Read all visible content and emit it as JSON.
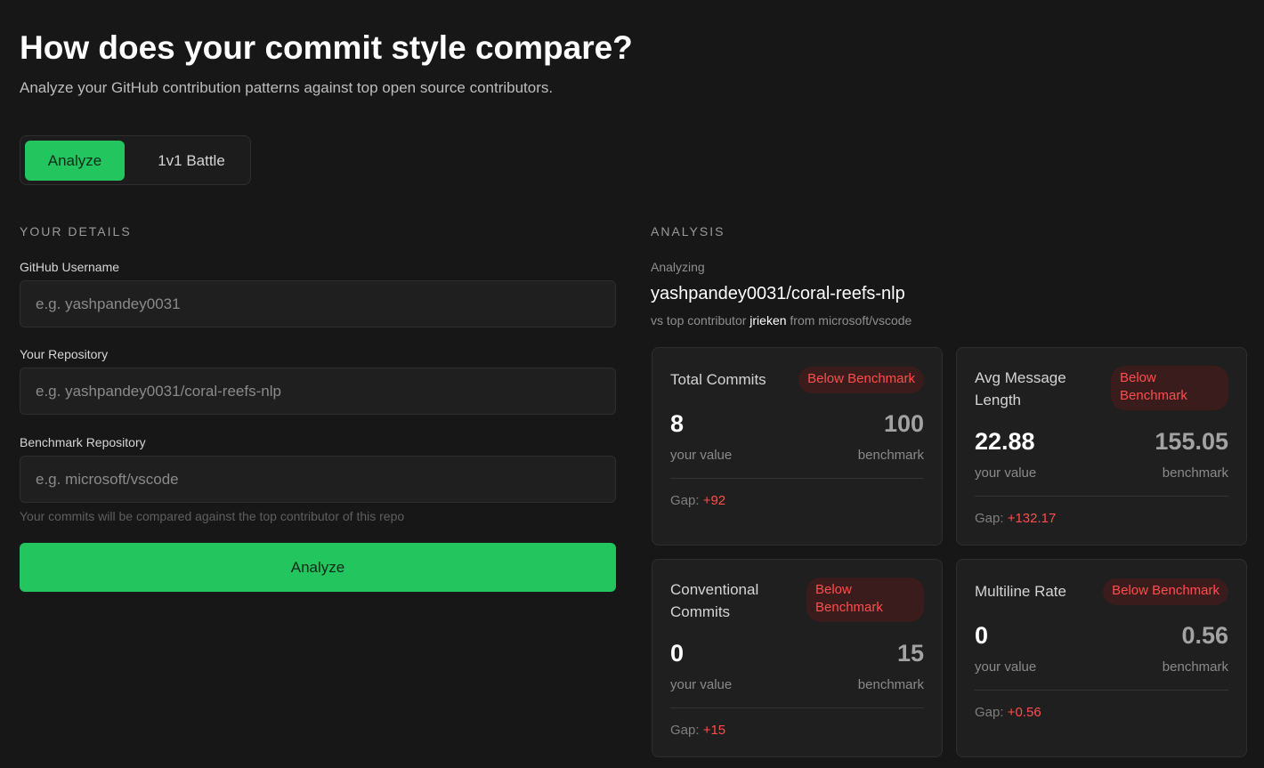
{
  "header": {
    "title": "How does your commit style compare?",
    "subtitle": "Analyze your GitHub contribution patterns against top open source contributors."
  },
  "mode_tabs": [
    {
      "label": "Analyze",
      "active": true
    },
    {
      "label": "1v1 Battle",
      "active": false
    }
  ],
  "form": {
    "section_label": "YOUR DETAILS",
    "username": {
      "label": "GitHub Username",
      "placeholder": "e.g. yashpandey0031",
      "value": ""
    },
    "repository": {
      "label": "Your Repository",
      "placeholder": "e.g. yashpandey0031/coral-reefs-nlp",
      "value": ""
    },
    "benchmark": {
      "label": "Benchmark Repository",
      "placeholder": "e.g. microsoft/vscode",
      "value": ""
    },
    "hint": "Your commits will be compared against the top contributor of this repo",
    "submit_label": "Analyze"
  },
  "analysis": {
    "section_label": "ANALYSIS",
    "analyzing_label": "Analyzing",
    "repo_name": "yashpandey0031/coral-reefs-nlp",
    "vs_prefix": "vs top contributor",
    "contributor": "jrieken",
    "from_text": "from microsoft/vscode",
    "your_caption": "your value",
    "bench_caption": "benchmark",
    "gap_prefix": "Gap:",
    "metrics": [
      {
        "name": "Total Commits",
        "badge": "Below Benchmark",
        "your_value": "8",
        "benchmark": "100",
        "gap": "+92"
      },
      {
        "name": "Avg Message Length",
        "badge": "Below Benchmark",
        "your_value": "22.88",
        "benchmark": "155.05",
        "gap": "+132.17"
      },
      {
        "name": "Conventional Commits",
        "badge": "Below Benchmark",
        "your_value": "0",
        "benchmark": "15",
        "gap": "+15"
      },
      {
        "name": "Multiline Rate",
        "badge": "Below Benchmark",
        "your_value": "0",
        "benchmark": "0.56",
        "gap": "+0.56"
      }
    ]
  },
  "colors": {
    "background": "#171717",
    "accent_green": "#22c55e",
    "warning_red": "#ff4d4d",
    "card_bg": "#1f1f1f"
  }
}
